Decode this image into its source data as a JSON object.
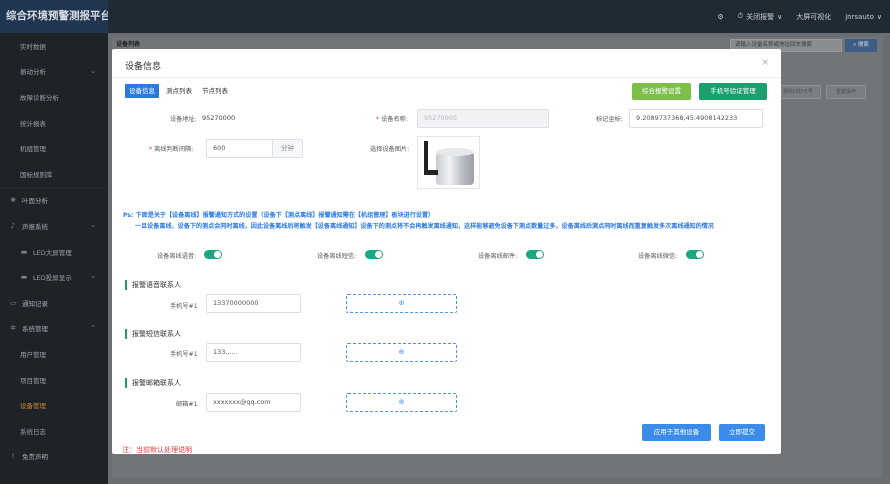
{
  "header": {
    "logo": "综合环境预警测报平台",
    "alarm_label": "关闭报警",
    "big_screen": "大屏可视化",
    "user": "jnrsauto"
  },
  "sidebar": {
    "items": [
      {
        "label": "实时数据"
      },
      {
        "label": "振动分析"
      },
      {
        "label": "故障诊断分析"
      },
      {
        "label": "统计报表"
      },
      {
        "label": "机组管理"
      },
      {
        "label": "国标规则库"
      },
      {
        "label": "叶面分析"
      },
      {
        "label": "声报系统"
      },
      {
        "label": "LED大屏管理"
      },
      {
        "label": "LED投屏显示"
      },
      {
        "label": "通知记录"
      },
      {
        "label": "系统管理"
      },
      {
        "label": "用户管理"
      },
      {
        "label": "项目管理"
      },
      {
        "label": "设备管理"
      },
      {
        "label": "系统日志"
      },
      {
        "label": "免责声明"
      }
    ]
  },
  "background": {
    "tab_label": "设备列表",
    "search_placeholder": "请输入设备名称或地址回车搜索",
    "search_button": "搜索",
    "btn_a": "删除LED卡号",
    "btn_b": "重置操作"
  },
  "modal": {
    "title": "设备信息",
    "close": "×",
    "tabs": [
      "设备信息",
      "测点列表",
      "节点列表"
    ],
    "btn_alarm_settings": "综合报警设置",
    "btn_phone_verify": "手机号验证管理",
    "fields": {
      "device_addr_label": "设备地址:",
      "device_addr_value": "95270000",
      "device_name_label": "设备名称:",
      "device_name_value": "95270005",
      "coords_label": "标记坐标:",
      "coords_value": "9.2089737368,45.4908142233",
      "offline_label": "离线判断间隔:",
      "offline_value": "600",
      "offline_unit": "分钟",
      "image_label": "选择设备图片:"
    },
    "notice": {
      "line1": "Ps: 下面是关于【设备离线】报警通知方式的设置（设备下【测点离线】报警通知需在【机组管理】板块进行设置）",
      "line2": "一旦设备离线，设备下的测点会同时离线，因此设备离线后将触发【设备离线通知】设备下的测点将不会再触发离线通知，这样能够避免设备下测点数量过多，设备离线后测点同时离线而重复触发多次离线通知的情况"
    },
    "toggles": [
      {
        "label": "设备离线语音:",
        "on": true
      },
      {
        "label": "设备离线短信:",
        "on": true
      },
      {
        "label": "设备离线邮件:",
        "on": true
      },
      {
        "label": "设备离线微信:",
        "on": true
      }
    ],
    "sections": {
      "voice": {
        "title": "报警语音联系人",
        "label": "手机号#1",
        "value": "13370000000"
      },
      "sms": {
        "title": "报警短信联系人",
        "label": "手机号#1",
        "value": "133......"
      },
      "mail": {
        "title": "报警邮箱联系人",
        "label": "邮箱#1",
        "value": "xxxxxxx@qq.com"
      }
    },
    "add_symbol": "⊕",
    "btn_apply_others": "应用于其他设备",
    "btn_submit": "立即提交",
    "footer_note": "注：当前默认处理说明"
  },
  "colors": {
    "primary": "#2a7ae2",
    "green": "#1b9f6e",
    "light_green": "#7cc04a",
    "sidebar_bg": "#1e2328",
    "active_menu": "#c98a2b"
  }
}
